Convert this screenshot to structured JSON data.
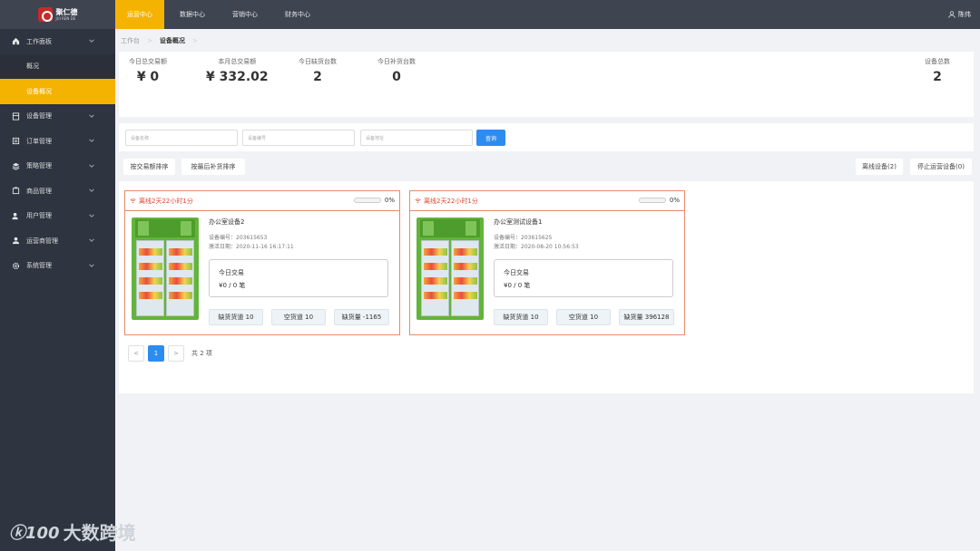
{
  "brand": {
    "name": "聚仁德",
    "sub": "JUI REN DE"
  },
  "nav": [
    {
      "label": "运营中心",
      "active": true
    },
    {
      "label": "数据中心",
      "active": false
    },
    {
      "label": "营销中心",
      "active": false
    },
    {
      "label": "财务中心",
      "active": false
    }
  ],
  "user": {
    "name": "陈伟"
  },
  "sidebar": {
    "items": [
      {
        "label": "工作面板",
        "icon": "home-icon"
      },
      {
        "label": "概况",
        "sub": true
      },
      {
        "label": "设备概况",
        "sub": true,
        "active": true
      },
      {
        "label": "设备管理",
        "icon": "device-icon"
      },
      {
        "label": "订单管理",
        "icon": "order-icon"
      },
      {
        "label": "策略管理",
        "icon": "layers-icon"
      },
      {
        "label": "商品管理",
        "icon": "goods-icon"
      },
      {
        "label": "用户管理",
        "icon": "user-icon"
      },
      {
        "label": "运营商管理",
        "icon": "operator-icon"
      },
      {
        "label": "系统管理",
        "icon": "gear-icon"
      }
    ]
  },
  "watermark": {
    "logo": "ⓚ100",
    "text": "大数跨境"
  },
  "breadcrumb": {
    "root": "工作台",
    "current": "设备概况",
    "sep": ">"
  },
  "stats": {
    "today_amount": {
      "label": "今日总交易额",
      "value": "¥ 0"
    },
    "month_amount": {
      "label": "本月总交易额",
      "value": "¥ 332.02"
    },
    "today_short": {
      "label": "今日缺货台数",
      "value": "2"
    },
    "today_restock": {
      "label": "今日补货台数",
      "value": "0"
    },
    "total_devices": {
      "label": "设备总数",
      "value": "2"
    }
  },
  "filters": {
    "name_placeholder": "设备名称",
    "code_placeholder": "设备编号",
    "addr_placeholder": "设备地址",
    "search_label": "查询"
  },
  "sorts": {
    "by_amount": "按交易额排序",
    "by_restock": "按最后补货排序",
    "offline": "离线设备(2)",
    "stopped": "停止运营设备(0)"
  },
  "cards": [
    {
      "status": "离线2天22小时1分",
      "progress": 0,
      "progress_label": "0%",
      "name": "办公室设备2",
      "code": "设备编号：203615653",
      "date": "激活日期：2020-11-16 16:17:11",
      "today_label": "今日交易",
      "today_value": "¥0 / 0 笔",
      "chip1": "缺货货道 10",
      "chip2": "空货道 10",
      "chip3": "缺货量 -1165"
    },
    {
      "status": "离线2天22小时1分",
      "progress": 0,
      "progress_label": "0%",
      "name": "办公室测试设备1",
      "code": "设备编号：203615625",
      "date": "激活日期：2020-08-20 10:56:53",
      "today_label": "今日交易",
      "today_value": "¥0 / 0 笔",
      "chip1": "缺货货道 10",
      "chip2": "空货道 10",
      "chip3": "缺货量 396128"
    }
  ],
  "pager": {
    "prev": "<",
    "current": "1",
    "next": ">",
    "total": "共 2 项"
  },
  "colors": {
    "accent": "#f5b301",
    "primary": "#2d8cf0",
    "alert": "#e1452c",
    "sidebar": "#2e3440",
    "topbar": "#3f4451"
  }
}
